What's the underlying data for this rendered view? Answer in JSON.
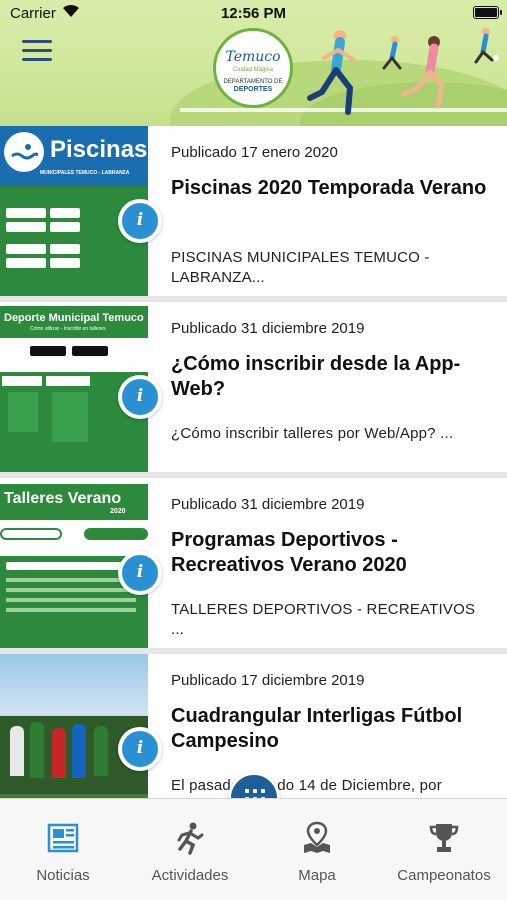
{
  "status": {
    "carrier": "Carrier",
    "time": "12:56 PM"
  },
  "header": {
    "logo_script": "Temuco",
    "logo_sub": "Ciudad Mágica",
    "logo_dept": "DEPARTAMENTO DE",
    "logo_dept2": "DEPORTES"
  },
  "news": [
    {
      "date": "Publicado 17 enero 2020",
      "title": "Piscinas 2020 Temporada Verano",
      "summary": "PISCINAS MUNICIPALES TEMUCO - LABRANZA...",
      "thumb_heading": "Piscinas",
      "thumb_sub": "MUNICIPALES TEMUCO - LABRANZA"
    },
    {
      "date": "Publicado 31 diciembre 2019",
      "title": "¿Cómo inscribir desde la App-Web?",
      "summary": "¿Cómo inscribir talleres por Web/App? ...",
      "thumb_heading": "Deporte Municipal Temuco",
      "thumb_sub": "Cómo utilizar - Inscribir en talleres"
    },
    {
      "date": "Publicado 31 diciembre 2019",
      "title": "Programas Deportivos - Recreativos Verano 2020",
      "summary": "TALLERES DEPORTIVOS - RECREATIVOS ...",
      "thumb_heading": "Talleres Verano",
      "thumb_sub": "2020"
    },
    {
      "date": "Publicado 17 diciembre 2019",
      "title": "Cuadrangular Interligas Fútbol Campesino",
      "summary": "El pasado sábado 14 de Diciembre, por",
      "thumb_heading": "",
      "thumb_sub": ""
    }
  ],
  "tabs": [
    {
      "label": "Noticias",
      "icon": "newspaper-icon"
    },
    {
      "label": "Actividades",
      "icon": "runner-icon"
    },
    {
      "label": "Mapa",
      "icon": "map-pin-icon"
    },
    {
      "label": "Campeonatos",
      "icon": "trophy-icon"
    }
  ],
  "colors": {
    "accent": "#2a90d4",
    "active_tab": "#2a90d4",
    "fab": "#1f5f97",
    "header_green": "#cfe79a"
  }
}
